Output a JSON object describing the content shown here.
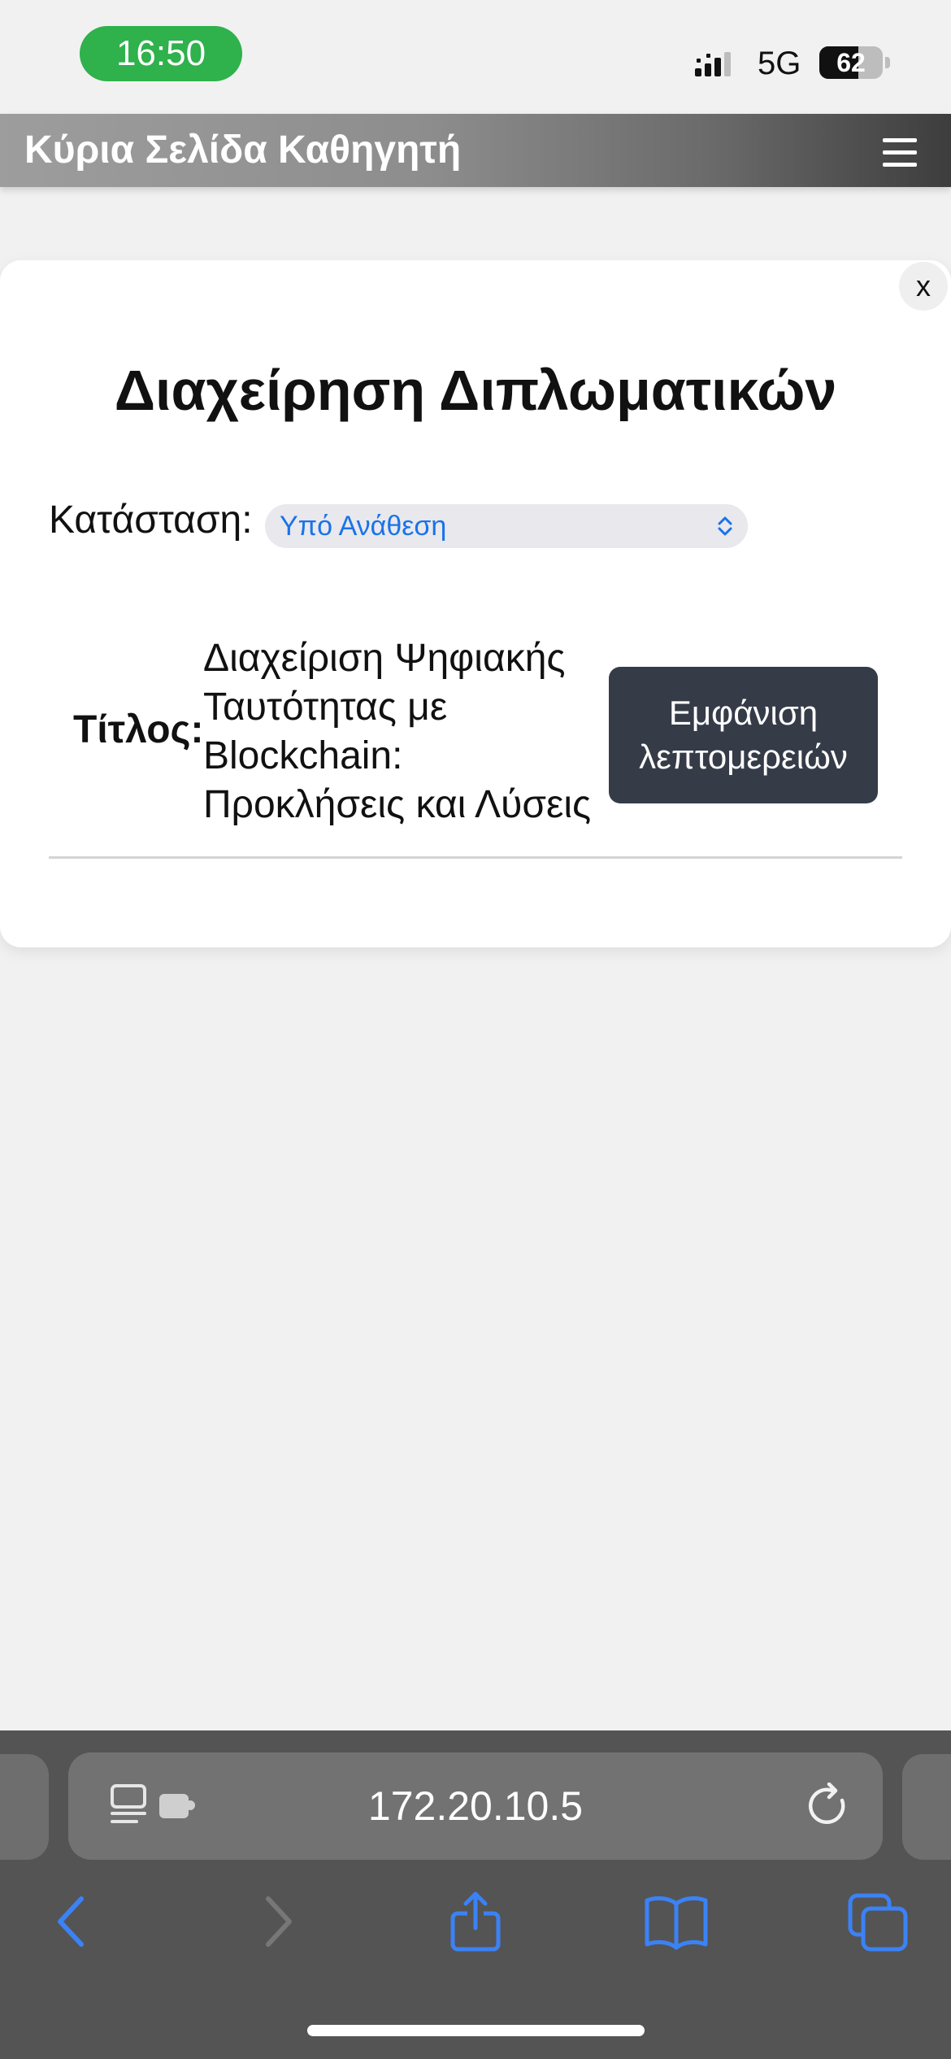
{
  "status_bar": {
    "time": "16:50",
    "network": "5G",
    "battery_percent": "62",
    "accent_color": "#2fb14c"
  },
  "header": {
    "title": "Κύρια Σελίδα Καθηγητή",
    "menu_icon": "hamburger-menu-icon"
  },
  "modal": {
    "close_label": "x",
    "title": "Διαχείρηση Διπλωματικών",
    "status_label": "Κατάσταση:",
    "status_selected": "Υπό Ανάθεση",
    "row": {
      "label": "Τίτλος:",
      "title_lines": [
        "Διαχείριση Ψηφιακής",
        "Ταυτότητας με",
        "Blockchain:",
        "Προκλήσεις και Λύσεις"
      ],
      "button_lines": [
        "Εμφάνιση",
        "λεπτομερειών"
      ]
    }
  },
  "browser": {
    "url": "172.20.10.5",
    "icons": [
      "back-icon",
      "forward-icon",
      "share-icon",
      "bookmarks-icon",
      "tabs-icon",
      "reader-icon",
      "reload-icon"
    ]
  }
}
